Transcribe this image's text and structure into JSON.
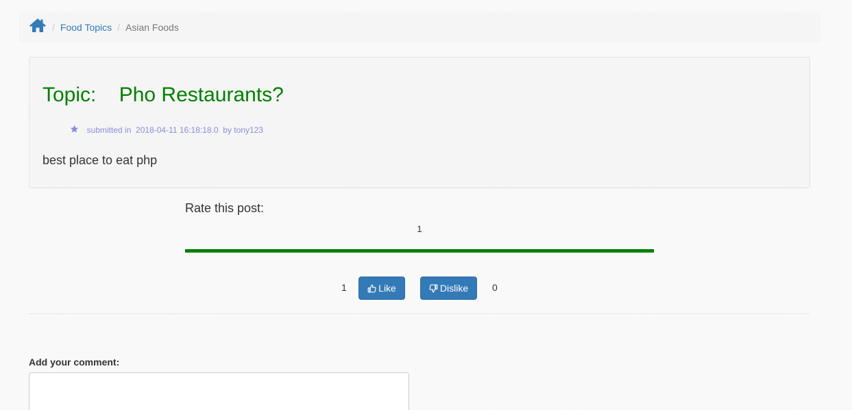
{
  "breadcrumb": {
    "home_icon": "home-icon",
    "items": [
      {
        "label": "Food Topics"
      },
      {
        "label": "Asian Foods"
      }
    ],
    "link_color": "#337ab7"
  },
  "topic": {
    "prefix": "Topic:",
    "title": "Pho Restaurants?",
    "title_color": "#008000",
    "meta": {
      "icon": "star-icon",
      "submitted_label": "submitted in",
      "timestamp": "2018-04-11 16:18:18.0",
      "by_label": "by tony123"
    },
    "body": "best place to eat php"
  },
  "rating": {
    "label": "Rate this post:",
    "value": "1",
    "fill_fraction": 1.0,
    "bar_color": "#008000"
  },
  "votes": {
    "likes": "1",
    "like_label": "Like",
    "like_icon": "thumbs-up-icon",
    "dislike_label": "Dislike",
    "dislike_icon": "thumbs-down-icon",
    "dislikes": "0",
    "button_color": "#337ab7"
  },
  "comment": {
    "label": "Add your comment:",
    "value": ""
  }
}
